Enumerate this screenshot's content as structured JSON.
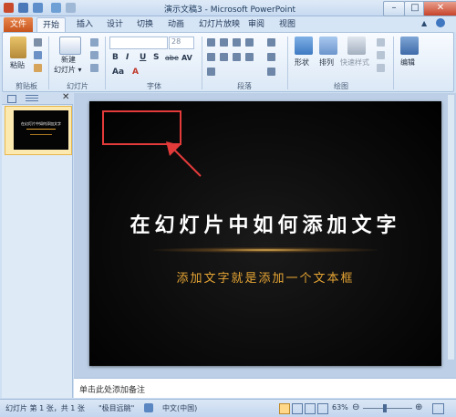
{
  "window": {
    "title": "演示文稿3 - Microsoft PowerPoint",
    "controls": [
      "–",
      "□",
      "✕"
    ]
  },
  "tabs": [
    "文件",
    "开始",
    "插入",
    "设计",
    "切换",
    "动画",
    "幻灯片放映",
    "审阅",
    "视图"
  ],
  "ribbon": {
    "clipboard": {
      "paste": "粘贴",
      "group": "剪贴板"
    },
    "slides": {
      "new_slide_1": "新建",
      "new_slide_2": "幻灯片 ▾",
      "group": "幻灯片"
    },
    "font": {
      "size": "28",
      "bold": "B",
      "italic": "I",
      "underline": "U",
      "shadow": "S",
      "strike": "abe",
      "spacing": "AV",
      "case": "Aa",
      "color": "A",
      "group": "字体"
    },
    "paragraph": {
      "group": "段落"
    },
    "drawing": {
      "shape": "形状",
      "arrange": "排列",
      "quick_style": "快速样式",
      "group": "绘图"
    },
    "editing": {
      "label": "编辑"
    }
  },
  "slide_panel": {
    "thumb_number": "1",
    "thumb_title": "在幻灯片中如何添加文字"
  },
  "slide": {
    "title": "在幻灯片中如何添加文字",
    "subtitle": "添加文字就是添加一个文本框"
  },
  "notes": {
    "placeholder": "单击此处添加备注"
  },
  "status": {
    "slide_info": "幻灯片 第 1 张，共 1 张",
    "theme": "\"极目远眺\"",
    "language": "中文(中国)",
    "zoom": "63%"
  },
  "colors": {
    "file_tab": "#d4652a",
    "annotation": "#e33a3a",
    "subtitle": "#e6a534"
  }
}
